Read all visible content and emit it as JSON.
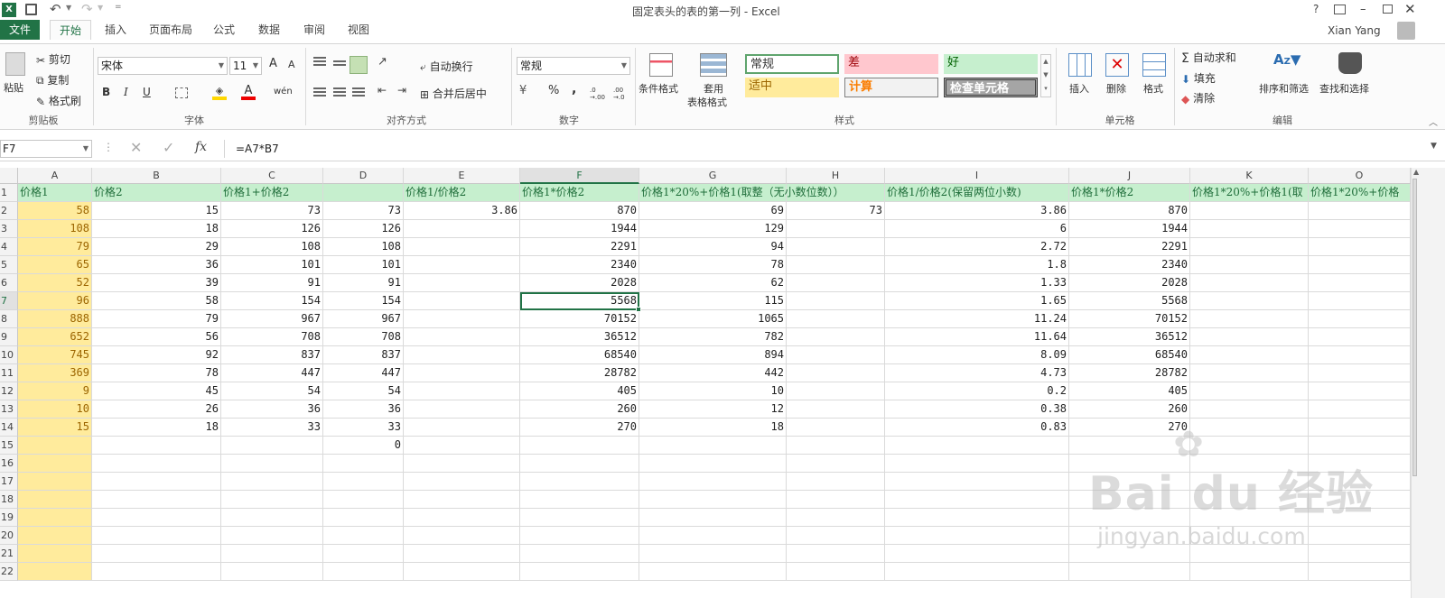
{
  "window": {
    "title": "固定表头的表的第一列 - Excel",
    "user": "Xian Yang",
    "help": "?"
  },
  "tabs": [
    {
      "label": "文件"
    },
    {
      "label": "开始"
    },
    {
      "label": "插入"
    },
    {
      "label": "页面布局"
    },
    {
      "label": "公式"
    },
    {
      "label": "数据"
    },
    {
      "label": "审阅"
    },
    {
      "label": "视图"
    }
  ],
  "ribbon": {
    "clipboard": {
      "paste": "粘贴",
      "cut": "剪切",
      "copy": "复制",
      "format_painter": "格式刷",
      "group": "剪贴板"
    },
    "font": {
      "name": "宋体",
      "size": "11",
      "group": "字体",
      "bold": "B",
      "italic": "I",
      "underline": "U",
      "grow": "A",
      "shrink": "A",
      "wen": "wén"
    },
    "alignment": {
      "wrap": "自动换行",
      "merge": "合并后居中",
      "group": "对齐方式"
    },
    "number": {
      "format": "常规",
      "percent": "%",
      "comma": ",",
      "inc": ".00 →.0",
      "dec": ".0 →.00",
      "group": "数字"
    },
    "styles": {
      "conditional": "条件格式",
      "table_format_1": "套用",
      "table_format_2": "表格格式",
      "normal": "常规",
      "bad": "差",
      "good": "好",
      "neutral": "适中",
      "calc": "计算",
      "check": "检查单元格",
      "group": "样式"
    },
    "cells": {
      "insert": "插入",
      "delete": "删除",
      "format": "格式",
      "group": "单元格"
    },
    "editing": {
      "autosum": "自动求和",
      "fill": "填充",
      "clear": "清除",
      "sort": "排序和筛选",
      "find": "查找和选择",
      "group": "编辑"
    }
  },
  "formula_bar": {
    "name_box": "F7",
    "fx": "fx",
    "formula": "=A7*B7"
  },
  "columns": [
    "A",
    "B",
    "C",
    "D",
    "E",
    "F",
    "G",
    "H",
    "I",
    "J",
    "K",
    "O"
  ],
  "rows": [
    "1",
    "2",
    "3",
    "4",
    "5",
    "6",
    "7",
    "8",
    "9",
    "10",
    "11",
    "12",
    "13",
    "14",
    "15",
    "16",
    "17",
    "18",
    "19",
    "20",
    "21",
    "22"
  ],
  "headers": {
    "A": "价格1",
    "B": "价格2",
    "C": "价格1+价格2",
    "E": "价格1/价格2",
    "F": "价格1*价格2",
    "G": "价格1*20%+价格1(取整（无小数位数））",
    "I": "价格1/价格2(保留两位小数)",
    "J": "价格1*价格2",
    "K": "价格1*20%+价格1(取",
    "O": "价格1*20%+价格"
  },
  "data": [
    {
      "A": "58",
      "B": "15",
      "C": "73",
      "D": "73",
      "E": "3.86",
      "F": "870",
      "G": "69",
      "H": "73",
      "I": "3.86",
      "J": "870"
    },
    {
      "A": "108",
      "B": "18",
      "C": "126",
      "D": "126",
      "E": "",
      "F": "1944",
      "G": "129",
      "H": "",
      "I": "6",
      "J": "1944"
    },
    {
      "A": "79",
      "B": "29",
      "C": "108",
      "D": "108",
      "E": "",
      "F": "2291",
      "G": "94",
      "H": "",
      "I": "2.72",
      "J": "2291"
    },
    {
      "A": "65",
      "B": "36",
      "C": "101",
      "D": "101",
      "E": "",
      "F": "2340",
      "G": "78",
      "H": "",
      "I": "1.8",
      "J": "2340"
    },
    {
      "A": "52",
      "B": "39",
      "C": "91",
      "D": "91",
      "E": "",
      "F": "2028",
      "G": "62",
      "H": "",
      "I": "1.33",
      "J": "2028"
    },
    {
      "A": "96",
      "B": "58",
      "C": "154",
      "D": "154",
      "E": "",
      "F": "5568",
      "G": "115",
      "H": "",
      "I": "1.65",
      "J": "5568"
    },
    {
      "A": "888",
      "B": "79",
      "C": "967",
      "D": "967",
      "E": "",
      "F": "70152",
      "G": "1065",
      "H": "",
      "I": "11.24",
      "J": "70152"
    },
    {
      "A": "652",
      "B": "56",
      "C": "708",
      "D": "708",
      "E": "",
      "F": "36512",
      "G": "782",
      "H": "",
      "I": "11.64",
      "J": "36512"
    },
    {
      "A": "745",
      "B": "92",
      "C": "837",
      "D": "837",
      "E": "",
      "F": "68540",
      "G": "894",
      "H": "",
      "I": "8.09",
      "J": "68540"
    },
    {
      "A": "369",
      "B": "78",
      "C": "447",
      "D": "447",
      "E": "",
      "F": "28782",
      "G": "442",
      "H": "",
      "I": "4.73",
      "J": "28782"
    },
    {
      "A": "9",
      "B": "45",
      "C": "54",
      "D": "54",
      "E": "",
      "F": "405",
      "G": "10",
      "H": "",
      "I": "0.2",
      "J": "405"
    },
    {
      "A": "10",
      "B": "26",
      "C": "36",
      "D": "36",
      "E": "",
      "F": "260",
      "G": "12",
      "H": "",
      "I": "0.38",
      "J": "260"
    },
    {
      "A": "15",
      "B": "18",
      "C": "33",
      "D": "33",
      "E": "",
      "F": "270",
      "G": "18",
      "H": "",
      "I": "0.83",
      "J": "270"
    },
    {
      "A": "",
      "B": "",
      "C": "",
      "D": "0",
      "E": "",
      "F": "",
      "G": "",
      "H": "",
      "I": "",
      "J": ""
    }
  ],
  "selected_cell": "F7",
  "watermark": {
    "brand": "Bai du 经验",
    "url": "jingyan.baidu.com"
  },
  "colors": {
    "accent": "#217346",
    "header_fill": "#c6efce",
    "col_a_fill": "#ffeb9c"
  }
}
